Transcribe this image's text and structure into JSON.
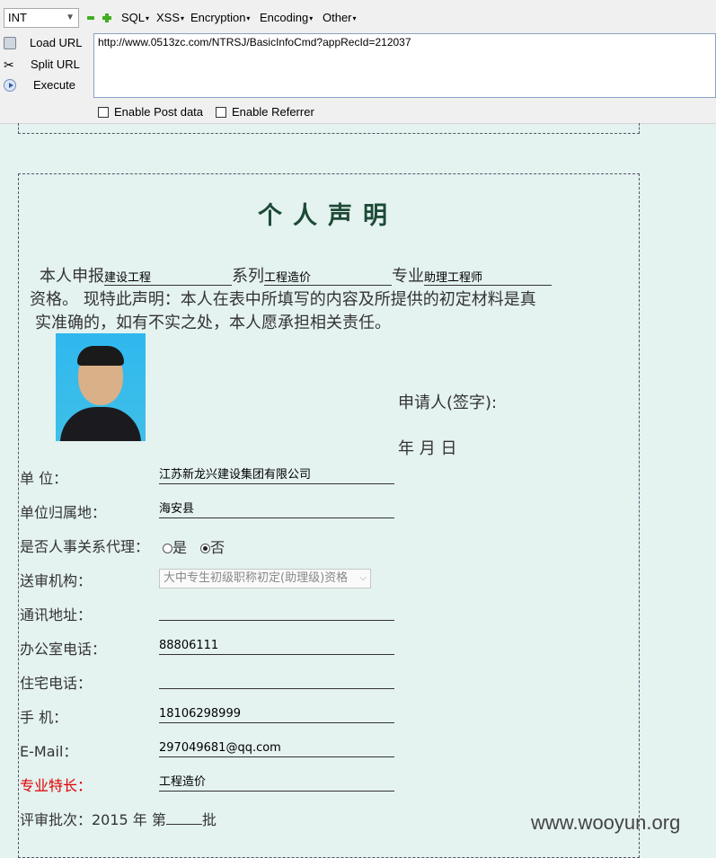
{
  "hackbar": {
    "select_value": "INT",
    "menus": [
      "SQL",
      "XSS",
      "Encryption",
      "Encoding",
      "Other"
    ],
    "actions": {
      "load": "Load URL",
      "split": "Split URL",
      "execute": "Execute"
    },
    "url": "http://www.0513zc.com/NTRSJ/BasicInfoCmd?appRecId=212037",
    "post_label": "Enable Post data",
    "referrer_label": "Enable Referrer"
  },
  "declaration": {
    "title": "个人声明",
    "prefix": "本人申报",
    "field1": "建设工程",
    "word_xi": "系列",
    "field2": "工程造价",
    "word_zhuanye": "专业",
    "field3": "助理工程师",
    "line2": "资格。 现特此声明：本人在表中所填写的内容及所提供的初定材料是真",
    "line3": "实准确的，如有不实之处，本人愿承担相关责任。",
    "signer_label": "申请人(签字):",
    "date_label": "年   月   日"
  },
  "form": {
    "unit_label": "单 位：",
    "unit_value": "江苏新龙兴建设集团有限公司",
    "region_label": "单位归属地：",
    "region_value": "海安县",
    "agent_label": "是否人事关系代理：",
    "agent_yes": "是",
    "agent_no": "否",
    "agency_label": "送审机构：",
    "agency_value": "大中专生初级职称初定(助理级)资格",
    "address_label": "通讯地址：",
    "address_value": "",
    "office_phone_label": "办公室电话：",
    "office_phone_value": "88806111",
    "home_phone_label": "住宅电话：",
    "home_phone_value": "",
    "mobile_label": "手 机：",
    "mobile_value": "18106298999",
    "email_label": "E-Mail：",
    "email_value": "297049681@qq.com",
    "specialty_label": "专业特长：",
    "specialty_value": "工程造价",
    "batch_text": "评审批次：2015 年  第",
    "batch_suffix": "批"
  },
  "watermark": "www.wooyun.org",
  "colors": {
    "page_bg": "#e4f2f0",
    "title": "#1d4a37",
    "specialty_label": "#e00000",
    "hackbar_icon": "#3fae1e"
  }
}
